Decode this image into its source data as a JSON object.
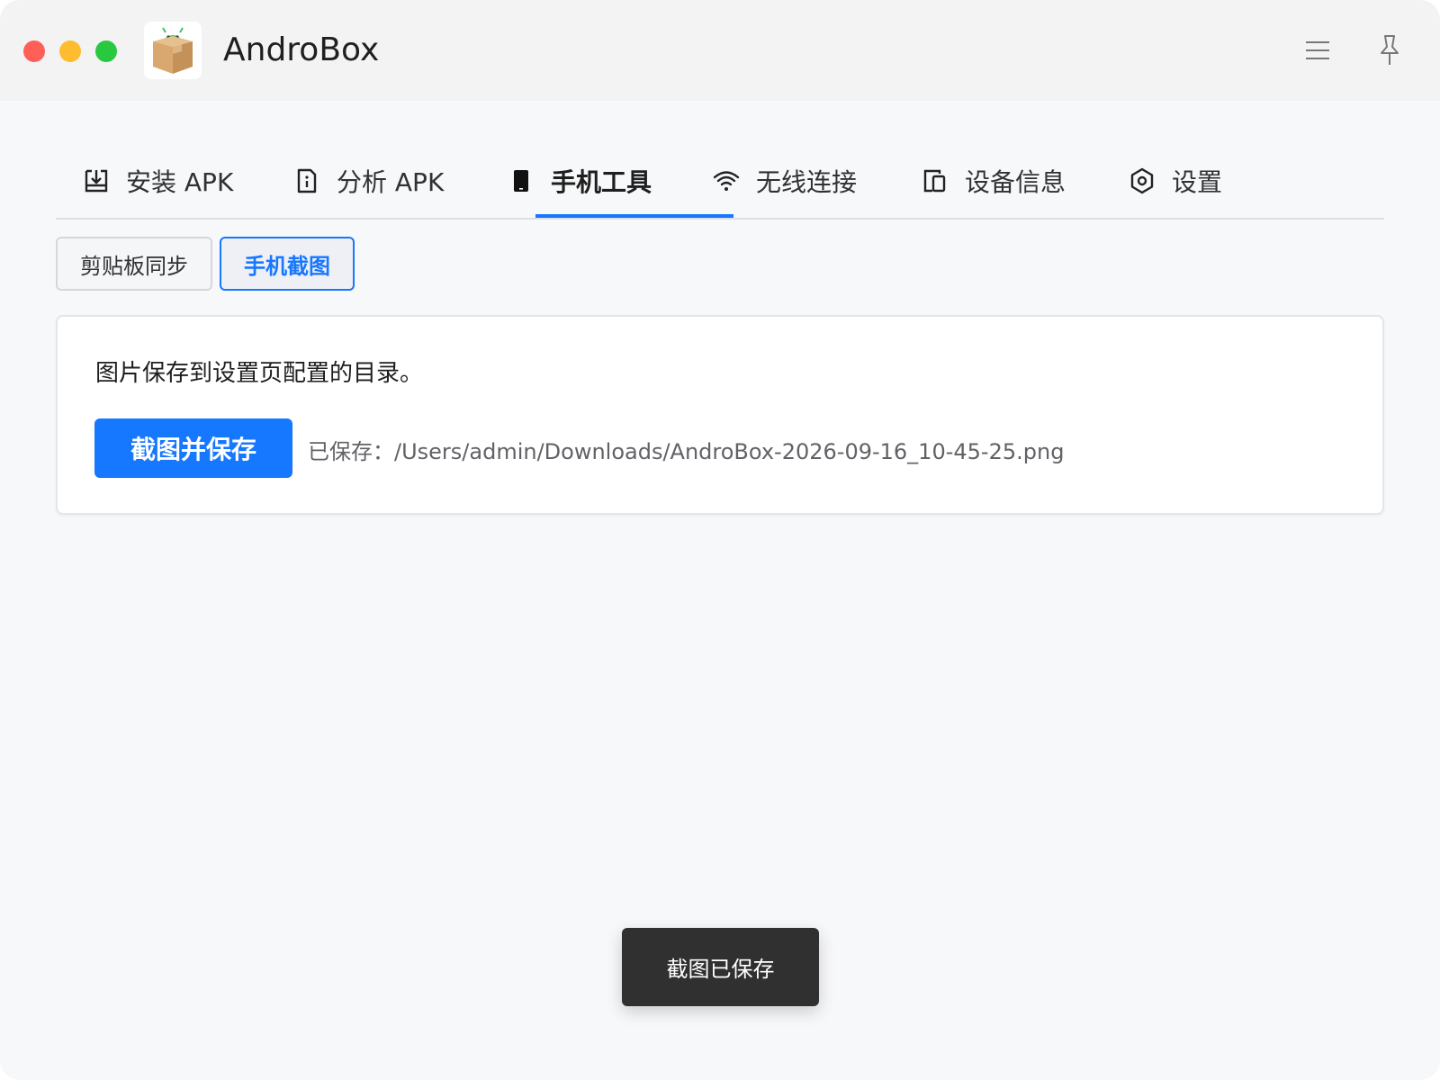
{
  "window": {
    "title": "AndroBox",
    "controls": [
      "close",
      "minimize",
      "maximize"
    ],
    "actions": [
      {
        "name": "menu-icon",
        "icon": "hamburger"
      },
      {
        "name": "pin-icon",
        "icon": "pin"
      }
    ]
  },
  "tabs": [
    {
      "label": "安装 APK",
      "icon": "install-icon",
      "active": false
    },
    {
      "label": "分析 APK",
      "icon": "file-info-icon",
      "active": false
    },
    {
      "label": "手机工具",
      "icon": "phone-icon",
      "active": true
    },
    {
      "label": "无线连接",
      "icon": "wifi-icon",
      "active": false
    },
    {
      "label": "设备信息",
      "icon": "devices-icon",
      "active": false
    },
    {
      "label": "设置",
      "icon": "settings-hex-icon",
      "active": false
    }
  ],
  "subtabs": [
    {
      "label": "剪贴板同步",
      "active": false
    },
    {
      "label": "手机截图",
      "active": true
    }
  ],
  "screenshot_panel": {
    "description": "图片保存到设置页配置的目录。",
    "button_label": "截图并保存",
    "saved_text": "已保存：/Users/admin/Downloads/AndroBox-2026-09-16_10-45-25.png"
  },
  "toast": {
    "message": "截图已保存"
  },
  "colors": {
    "accent": "#1677ff",
    "background": "#f7f8fa",
    "titlebar": "#f3f3f4",
    "toast_bg": "#303030"
  }
}
